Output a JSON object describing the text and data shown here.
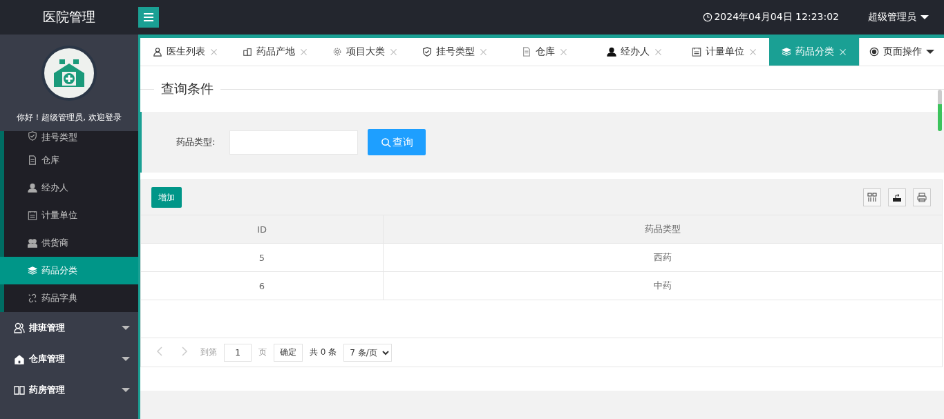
{
  "header": {
    "title": "医院管理",
    "datetime": "2024年04月04日 12:23:02",
    "user": "超级管理员"
  },
  "sidebar": {
    "greeting": "你好！超级管理员, 欢迎登录",
    "items": [
      {
        "label": "挂号类型",
        "selected": false
      },
      {
        "label": "仓库",
        "selected": false
      },
      {
        "label": "经办人",
        "selected": false
      },
      {
        "label": "计量单位",
        "selected": false
      },
      {
        "label": "供货商",
        "selected": false
      },
      {
        "label": "药品分类",
        "selected": true
      },
      {
        "label": "药品字典",
        "selected": false
      }
    ],
    "groups": [
      {
        "label": "排班管理"
      },
      {
        "label": "仓库管理"
      },
      {
        "label": "药房管理"
      }
    ]
  },
  "tabs": [
    {
      "label": "医生列表",
      "selected": false
    },
    {
      "label": "药品产地",
      "selected": false
    },
    {
      "label": "项目大类",
      "selected": false
    },
    {
      "label": "挂号类型",
      "selected": false
    },
    {
      "label": "仓库",
      "selected": false
    },
    {
      "label": "经办人",
      "selected": false
    },
    {
      "label": "计量单位",
      "selected": false
    },
    {
      "label": "药品分类",
      "selected": true
    }
  ],
  "page_ops": "页面操作",
  "query": {
    "legend": "查询条件",
    "field_label": "药品类型:",
    "button": "查询"
  },
  "toolbar": {
    "add": "增加"
  },
  "table": {
    "columns": [
      "ID",
      "药品类型"
    ],
    "rows": [
      [
        "5",
        "西药"
      ],
      [
        "6",
        "中药"
      ]
    ]
  },
  "pager": {
    "goto": "到第",
    "page": "1",
    "unit": "页",
    "confirm": "确定",
    "total": "共 0 条",
    "page_size": "7 条/页"
  }
}
